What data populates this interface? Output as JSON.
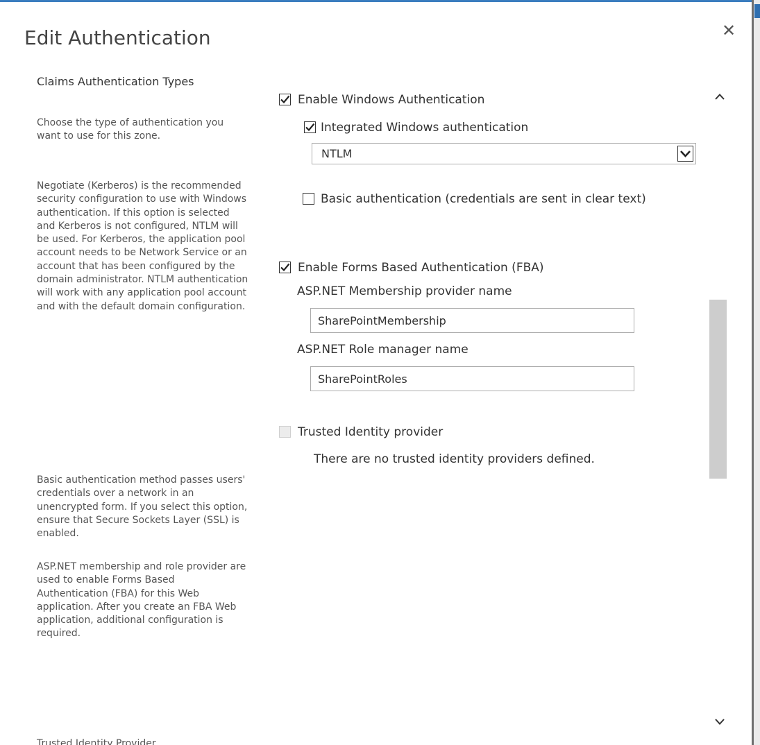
{
  "dialog": {
    "title": "Edit Authentication",
    "close_icon": "close-icon"
  },
  "left_panel": {
    "heading": "Claims Authentication Types",
    "paragraphs": [
      "Choose the type of authentication you want to use for this zone.",
      "Negotiate (Kerberos) is the recommended security configuration to use with Windows authentication. If this option is selected and Kerberos is not configured, NTLM will be used. For Kerberos, the application pool account needs to be Network Service or an account that has been configured by the domain administrator. NTLM authentication will work with any application pool account and with the default domain configuration.",
      "Basic authentication method passes users' credentials over a network in an unencrypted form. If you select this option, ensure that Secure Sockets Layer (SSL) is enabled.",
      "ASP.NET membership and role provider are used to enable Forms Based Authentication (FBA) for this Web application. After you create an FBA Web application, additional configuration is required."
    ],
    "cutoff_heading": "Trusted Identity Provider"
  },
  "form": {
    "windows_auth": {
      "label": "Enable Windows Authentication",
      "checked": true
    },
    "integrated_windows": {
      "label": "Integrated Windows authentication",
      "checked": true,
      "selected_value": "NTLM"
    },
    "basic_auth": {
      "label": "Basic authentication (credentials are sent in clear text)",
      "checked": false
    },
    "fba": {
      "label": "Enable Forms Based Authentication (FBA)",
      "checked": true,
      "membership_label": "ASP.NET Membership provider name",
      "membership_value": "SharePointMembership",
      "role_label": "ASP.NET Role manager name",
      "role_value": "SharePointRoles"
    },
    "trusted": {
      "label": "Trusted Identity provider",
      "checked": false,
      "disabled": true,
      "note": "There are no trusted identity providers defined."
    }
  },
  "colors": {
    "accent_bar": "#3b7dbf",
    "text": "#444444",
    "scroll_thumb": "#cdcdcd"
  }
}
